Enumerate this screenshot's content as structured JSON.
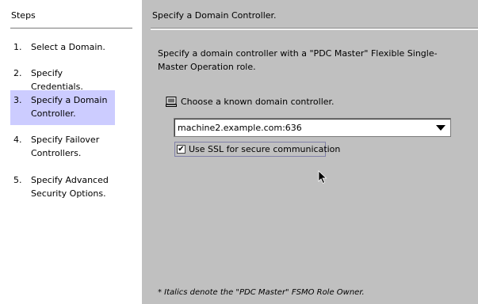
{
  "steps_panel": {
    "title": "Steps",
    "items": [
      {
        "number": "1.",
        "label": "Select a Domain."
      },
      {
        "number": "2.",
        "label": "Specify Credentials."
      },
      {
        "number": "3.",
        "label": "Specify a Domain Controller.",
        "current": true
      },
      {
        "number": "4.",
        "label": "Specify Failover Controllers."
      },
      {
        "number": "5.",
        "label": "Specify Advanced Security Options."
      }
    ]
  },
  "content": {
    "title": "Specify a Domain Controller.",
    "description": "Specify a domain controller with a \"PDC Master\" Flexible Single-Master Operation role.",
    "choose_option_label": "Choose a known domain controller.",
    "controller_select": {
      "value": "machine2.example.com:636"
    },
    "ssl_checkbox": {
      "label": "Use SSL for secure communication",
      "checked": true,
      "check_glyph": "✔"
    },
    "footnote": "* Italics denote the \"PDC Master\" FSMO Role Owner."
  },
  "colors": {
    "sidebar_bg": "#ffffff",
    "content_bg": "#c0c0c0",
    "current_step_bg": "#ccccff"
  }
}
